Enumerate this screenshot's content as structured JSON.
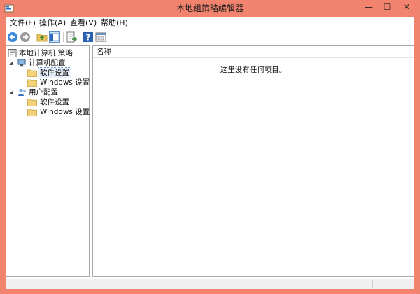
{
  "window": {
    "title": "本地组策略编辑器",
    "frame_color": "#f1836f",
    "controls": {
      "minimize": "—",
      "maximize": "☐",
      "close": "✕"
    }
  },
  "menu": [
    {
      "label": "文件(F)"
    },
    {
      "label": "操作(A)"
    },
    {
      "label": "查看(V)"
    },
    {
      "label": "帮助(H)"
    }
  ],
  "toolbar": {
    "buttons": [
      {
        "name": "back-arrow-icon"
      },
      {
        "name": "forward-arrow-icon"
      },
      {
        "name": "up-folder-icon"
      },
      {
        "name": "show-hide-tree-icon"
      },
      {
        "name": "export-list-icon"
      },
      {
        "name": "help-icon"
      },
      {
        "name": "properties-icon"
      }
    ]
  },
  "tree": {
    "root": "本地计算机 策略",
    "computer_config": "计算机配置",
    "computer_children": [
      "软件设置",
      "Windows 设置"
    ],
    "user_config": "用户配置",
    "user_children": [
      "软件设置",
      "Windows 设置"
    ],
    "selected": "软件设置"
  },
  "list": {
    "column_name": "名称",
    "empty_message": "这里没有任何项目。"
  }
}
